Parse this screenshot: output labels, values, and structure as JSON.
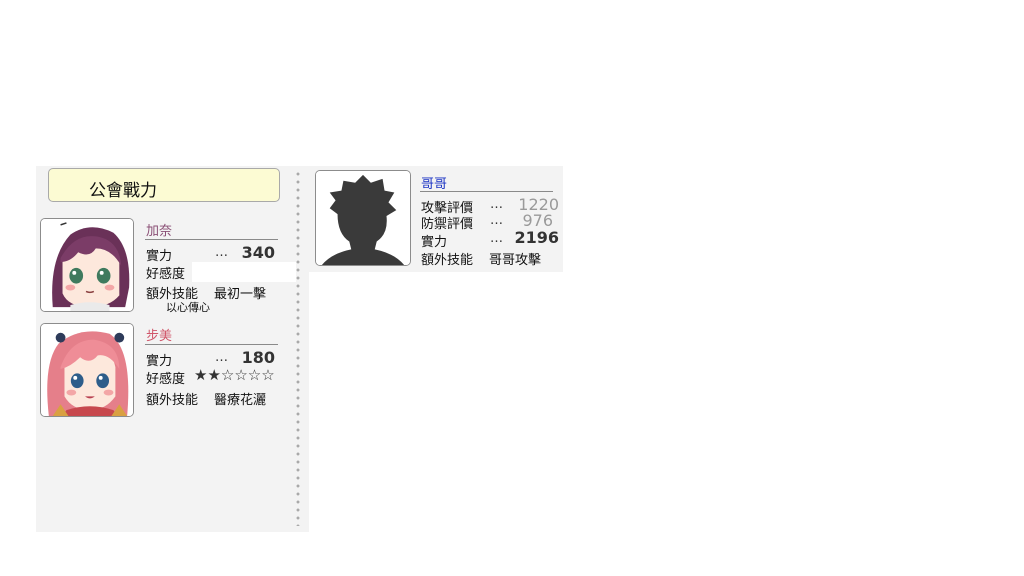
{
  "panel": {
    "title": "公會戰力"
  },
  "members": [
    {
      "name": "加奈",
      "name_color": "#8a4f75",
      "power_label": "實力",
      "power_dots": "…",
      "power": "340",
      "affection_label": "好感度",
      "affection_stars": "",
      "skill_label": "額外技能",
      "skill": "最初一擊",
      "skill_sub": "以心傳心"
    },
    {
      "name": "步美",
      "name_color": "#d0566a",
      "power_label": "實力",
      "power_dots": "…",
      "power": "180",
      "affection_label": "好感度",
      "affection_stars": "★★☆☆☆☆",
      "skill_label": "額外技能",
      "skill": "醫療花灑",
      "skill_sub": ""
    }
  ],
  "brother": {
    "name": "哥哥",
    "name_color": "#1c34c4",
    "attack_label": "攻擊評價",
    "attack_dots": "…",
    "attack": "1220",
    "defense_label": "防禦評價",
    "defense_dots": "…",
    "defense": "976",
    "power_label": "實力",
    "power_dots": "…",
    "power": "2196",
    "skill_label": "額外技能",
    "skill": "哥哥攻擊"
  }
}
